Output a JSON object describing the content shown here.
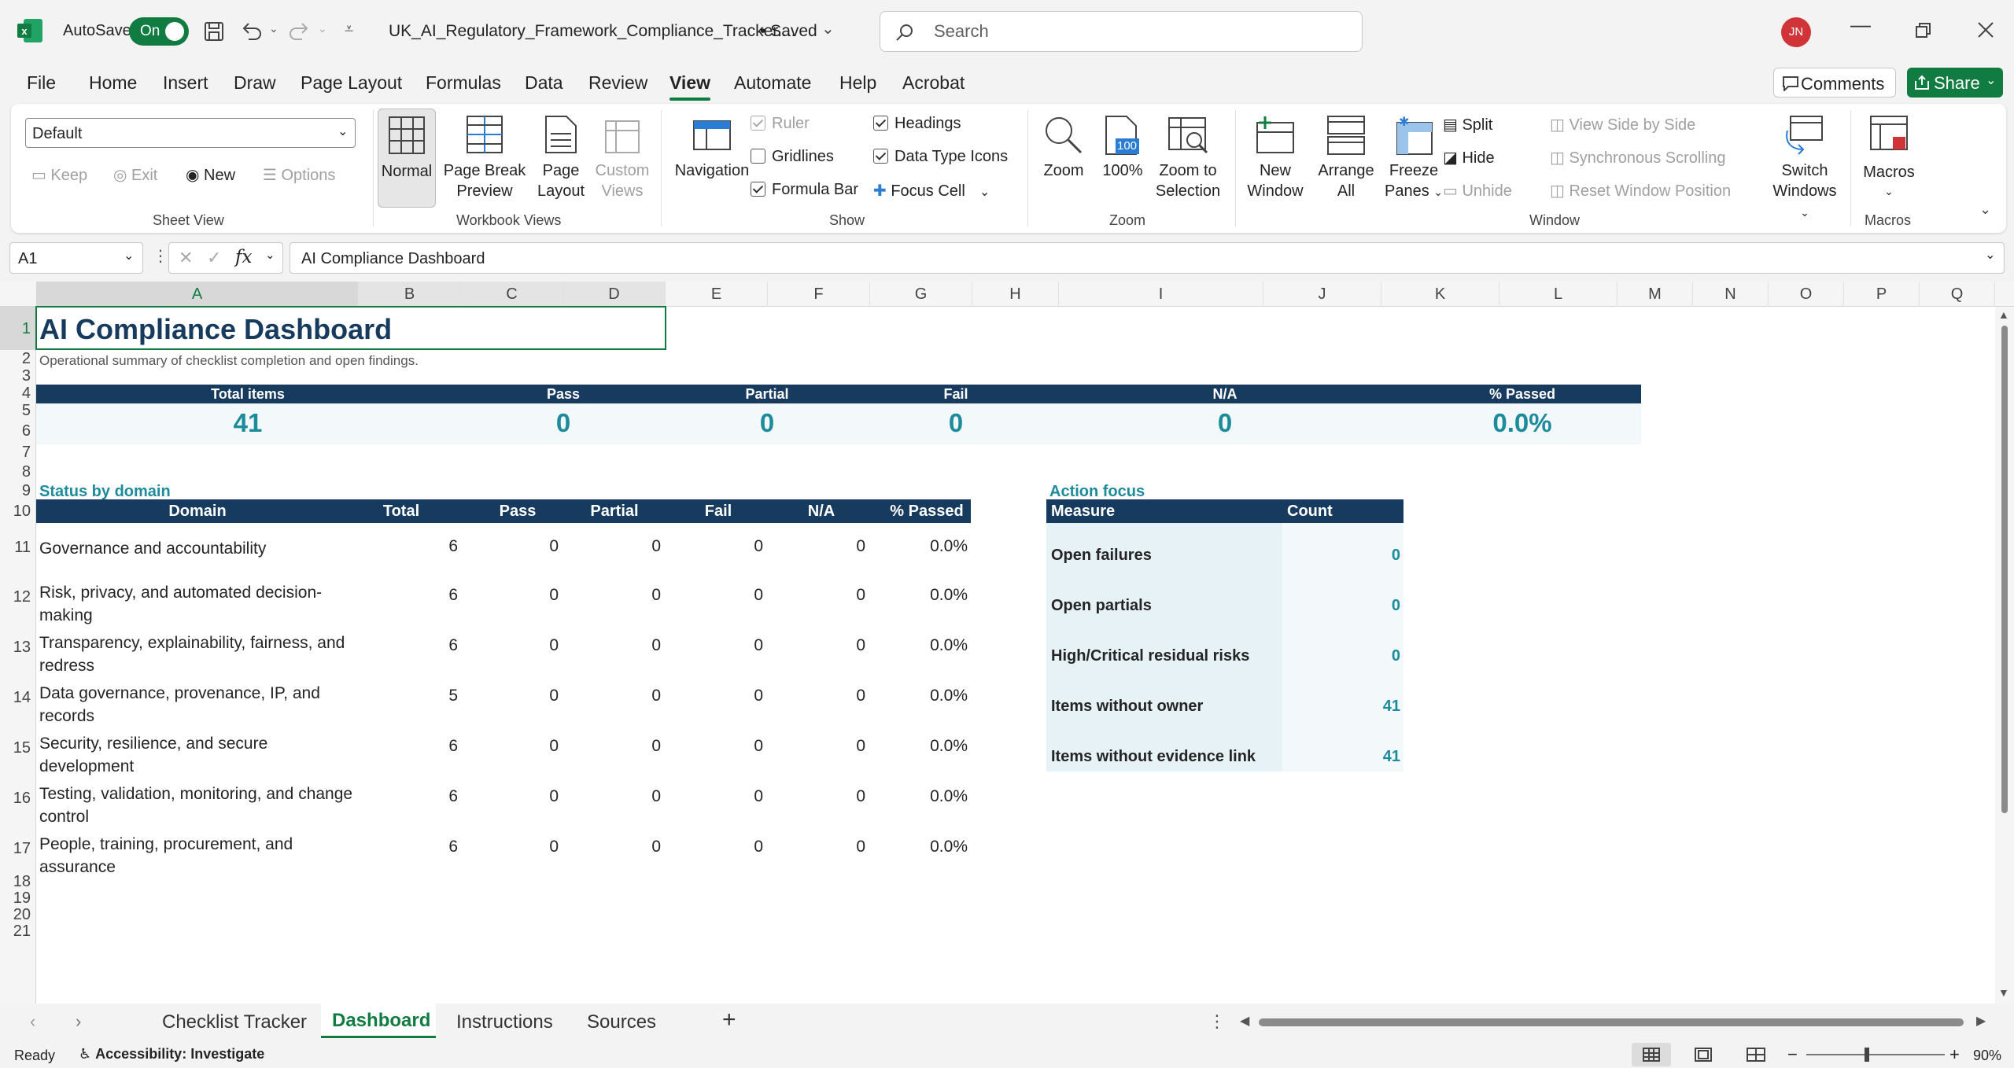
{
  "app": {
    "autosave_label": "AutoSave",
    "autosave_state": "On",
    "doc_title": "UK_AI_Regulatory_Framework_Compliance_Tracker....",
    "saved": "• Saved",
    "search_placeholder": "Search",
    "user_initials": "JN"
  },
  "menu": [
    "File",
    "Home",
    "Insert",
    "Draw",
    "Page Layout",
    "Formulas",
    "Data",
    "Review",
    "View",
    "Automate",
    "Help",
    "Acrobat"
  ],
  "menu_active": "View",
  "top_buttons": {
    "comments": "Comments",
    "share": "Share"
  },
  "ribbon": {
    "sheet_view": {
      "select": "Default",
      "keep": "Keep",
      "exit": "Exit",
      "new": "New",
      "options": "Options",
      "group": "Sheet View"
    },
    "workbook_views": {
      "normal": "Normal",
      "page_break_1": "Page Break",
      "page_break_2": "Preview",
      "page_layout_1": "Page",
      "page_layout_2": "Layout",
      "custom_1": "Custom",
      "custom_2": "Views",
      "group": "Workbook Views"
    },
    "show": {
      "navigation": "Navigation",
      "ruler": "Ruler",
      "gridlines": "Gridlines",
      "formula_bar": "Formula Bar",
      "headings": "Headings",
      "data_type_icons": "Data Type Icons",
      "focus_cell": "Focus Cell",
      "group": "Show"
    },
    "zoom": {
      "zoom": "Zoom",
      "hundred": "100%",
      "icon_100": "100",
      "zoom_sel_1": "Zoom to",
      "zoom_sel_2": "Selection",
      "group": "Zoom"
    },
    "window": {
      "new_1": "New",
      "new_2": "Window",
      "arrange_1": "Arrange",
      "arrange_2": "All",
      "freeze_1": "Freeze",
      "freeze_2": "Panes",
      "split": "Split",
      "hide": "Hide",
      "unhide": "Unhide",
      "side": "View Side by Side",
      "sync": "Synchronous Scrolling",
      "reset": "Reset Window Position",
      "switch_1": "Switch",
      "switch_2": "Windows",
      "group": "Window"
    },
    "macros": {
      "label": "Macros",
      "group": "Macros"
    }
  },
  "formula_bar": {
    "name_box": "A1",
    "fx": "fx",
    "content": "AI Compliance Dashboard"
  },
  "columns": [
    "A",
    "B",
    "C",
    "D",
    "E",
    "F",
    "G",
    "H",
    "I",
    "J",
    "K",
    "L",
    "M",
    "N",
    "O",
    "P",
    "Q"
  ],
  "rows": [
    "1",
    "2",
    "3",
    "4",
    "5",
    "6",
    "7",
    "8",
    "9",
    "10",
    "11",
    "12",
    "13",
    "14",
    "15",
    "16",
    "17",
    "18",
    "19",
    "20",
    "21"
  ],
  "dashboard": {
    "title": "AI Compliance Dashboard",
    "subtitle": "Operational summary of checklist completion and open findings.",
    "kpis": [
      {
        "label": "Total items",
        "value": "41"
      },
      {
        "label": "Pass",
        "value": "0"
      },
      {
        "label": "Partial",
        "value": "0"
      },
      {
        "label": "Fail",
        "value": "0"
      },
      {
        "label": "N/A",
        "value": "0"
      },
      {
        "label": "% Passed",
        "value": "0.0%"
      }
    ],
    "domain_title": "Status by domain",
    "domain_headers": [
      "Domain",
      "Total",
      "Pass",
      "Partial",
      "Fail",
      "N/A",
      "% Passed"
    ],
    "domain_rows": [
      {
        "line1": "Governance and accountability",
        "line2": "",
        "total": "6",
        "pass": "0",
        "partial": "0",
        "fail": "0",
        "na": "0",
        "pct": "0.0%"
      },
      {
        "line1": "Risk, privacy, and automated decision-",
        "line2": "making",
        "total": "6",
        "pass": "0",
        "partial": "0",
        "fail": "0",
        "na": "0",
        "pct": "0.0%"
      },
      {
        "line1": "Transparency, explainability, fairness, and",
        "line2": "redress",
        "total": "6",
        "pass": "0",
        "partial": "0",
        "fail": "0",
        "na": "0",
        "pct": "0.0%"
      },
      {
        "line1": "Data governance, provenance, IP, and",
        "line2": "records",
        "total": "5",
        "pass": "0",
        "partial": "0",
        "fail": "0",
        "na": "0",
        "pct": "0.0%"
      },
      {
        "line1": "Security, resilience, and secure",
        "line2": "development",
        "total": "6",
        "pass": "0",
        "partial": "0",
        "fail": "0",
        "na": "0",
        "pct": "0.0%"
      },
      {
        "line1": "Testing, validation, monitoring, and change",
        "line2": "control",
        "total": "6",
        "pass": "0",
        "partial": "0",
        "fail": "0",
        "na": "0",
        "pct": "0.0%"
      },
      {
        "line1": "People, training, procurement, and",
        "line2": "assurance",
        "total": "6",
        "pass": "0",
        "partial": "0",
        "fail": "0",
        "na": "0",
        "pct": "0.0%"
      }
    ],
    "action_title": "Action focus",
    "action_headers": [
      "Measure",
      "Count"
    ],
    "action_rows": [
      {
        "measure": "Open failures",
        "count": "0"
      },
      {
        "measure": "Open partials",
        "count": "0"
      },
      {
        "measure": "High/Critical residual risks",
        "count": "0"
      },
      {
        "measure": "Items without owner",
        "count": "41"
      },
      {
        "measure": "Items without evidence link",
        "count": "41"
      }
    ]
  },
  "sheets": [
    "Checklist Tracker",
    "Dashboard",
    "Instructions",
    "Sources"
  ],
  "active_sheet": "Dashboard",
  "status": {
    "ready": "Ready",
    "accessibility": "Accessibility: Investigate",
    "zoom": "90%"
  },
  "colors": {
    "header_navy": "#173b5e",
    "kpi_teal": "#1c8b9b",
    "excel_green": "#107c41"
  }
}
